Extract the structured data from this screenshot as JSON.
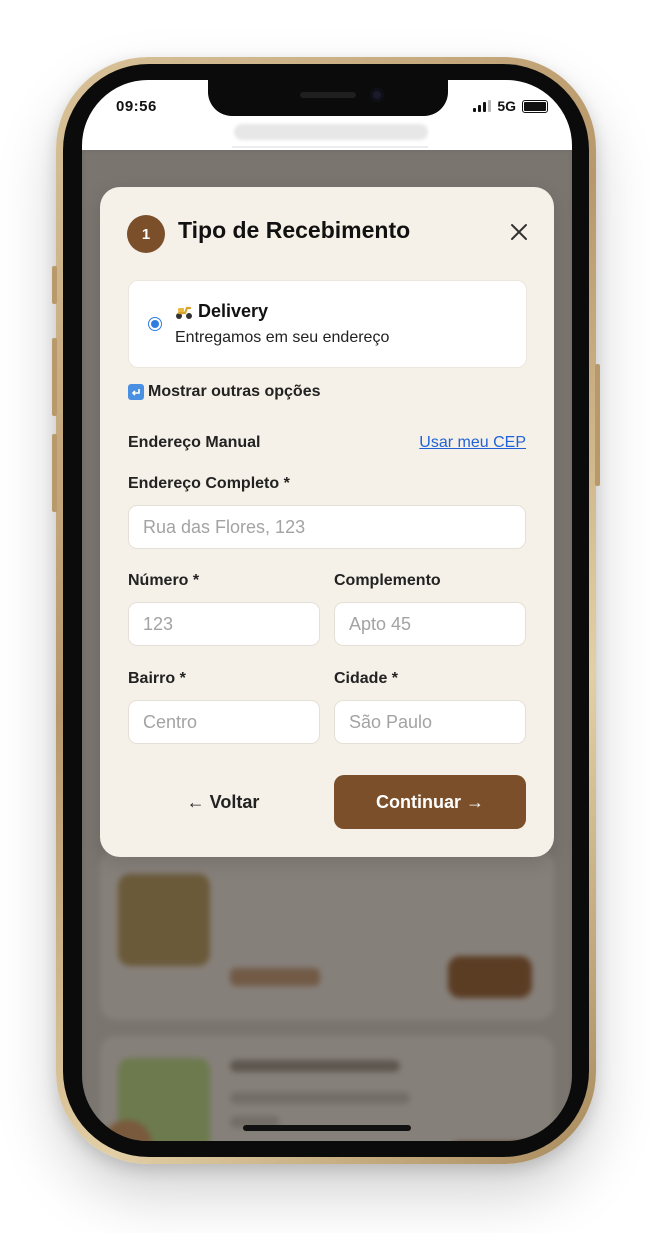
{
  "status_bar": {
    "time": "09:56",
    "network": "5G",
    "icons": [
      "signal-icon",
      "battery-icon"
    ]
  },
  "modal": {
    "step_number": "1",
    "title": "Tipo de Recebimento",
    "close_icon": "close-icon",
    "selected_option": {
      "icon": "scooter-icon",
      "title": "Delivery",
      "description": "Entregamos em seu endereço"
    },
    "more_options_label": "Mostrar outras opções",
    "more_options_icon": "return-icon",
    "address_mode_label": "Endereço Manual",
    "cep_link": "Usar meu CEP",
    "fields": {
      "full_address": {
        "label": "Endereço Completo *",
        "placeholder": "Rua das Flores, 123"
      },
      "number": {
        "label": "Número *",
        "placeholder": "123"
      },
      "complement": {
        "label": "Complemento",
        "placeholder": "Apto 45"
      },
      "neighborhood": {
        "label": "Bairro *",
        "placeholder": "Centro"
      },
      "city": {
        "label": "Cidade *",
        "placeholder": "São Paulo"
      }
    },
    "back_button": "← Voltar",
    "continue_button": "Continuar →"
  },
  "colors": {
    "accent": "#7a4f2a",
    "modal_background": "#f6f1e8",
    "link": "#2163d6",
    "radio": "#2f7de1"
  }
}
